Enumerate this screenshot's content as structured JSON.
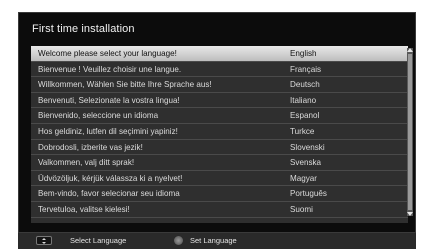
{
  "screen": {
    "title": "First time installation"
  },
  "languages": [
    {
      "phrase": "Welcome please select your language!",
      "language": "English",
      "selected": true
    },
    {
      "phrase": "Bienvenue ! Veuillez choisir une langue.",
      "language": "Français"
    },
    {
      "phrase": "Willkommen, Wählen Sie bitte Ihre Sprache aus!",
      "language": "Deutsch"
    },
    {
      "phrase": "Benvenuti, Selezionate la vostra lingua!",
      "language": "Italiano"
    },
    {
      "phrase": "Bienvenido, seleccione un idioma",
      "language": "Espanol"
    },
    {
      "phrase": "Hos geldiniz, lutfen dil seçimini yapiniz!",
      "language": "Turkce"
    },
    {
      "phrase": "Dobrodosli, izberite vas jezik!",
      "language": "Slovenski"
    },
    {
      "phrase": "Valkommen, valj ditt sprak!",
      "language": "Svenska"
    },
    {
      "phrase": "Üdvözöljuk, kérjük válassza ki a nyelvet!",
      "language": "Magyar"
    },
    {
      "phrase": "Bem-vindo, favor selecionar seu idioma",
      "language": "Português"
    },
    {
      "phrase": "Tervetuloa, valitse kielesi!",
      "language": "Suomi"
    }
  ],
  "footer": {
    "select_label": "Select Language",
    "set_label": "Set Language"
  },
  "icons": {
    "navigate": "up-down-key-icon",
    "confirm": "ok-button-icon"
  },
  "colors": {
    "background": "#0c0c0c",
    "list_background": "#2f2f2f",
    "highlight": "#d6d6d6",
    "text": "#dcdcdc"
  }
}
